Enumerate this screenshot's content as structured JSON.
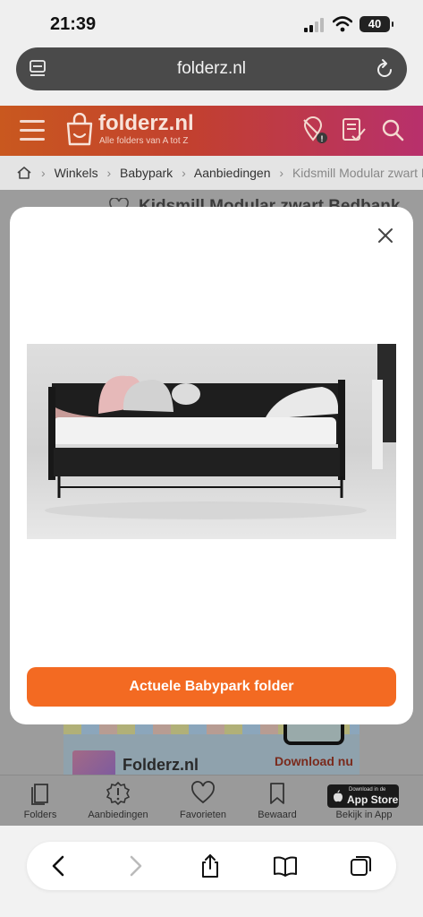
{
  "status_bar": {
    "time": "21:39",
    "battery": "40"
  },
  "browser": {
    "url": "folderz.nl"
  },
  "site_header": {
    "logo_text": "folderz.nl",
    "logo_tagline": "Alle folders van A tot Z"
  },
  "breadcrumb": {
    "items": [
      "Winkels",
      "Babypark",
      "Aanbiedingen"
    ],
    "current": "Kidsmill Modular zwart Bedbank"
  },
  "page": {
    "title": "Kidsmill Modular zwart Bedbank"
  },
  "ad_banner": {
    "brand": "Folderz.nl",
    "download": "Download nu"
  },
  "modal": {
    "cta_label": "Actuele Babypark folder"
  },
  "bottom_nav": {
    "items": [
      {
        "label": "Folders",
        "icon": "folders-icon"
      },
      {
        "label": "Aanbiedingen",
        "icon": "offers-badge-icon"
      },
      {
        "label": "Favorieten",
        "icon": "heart-icon"
      },
      {
        "label": "Bewaard",
        "icon": "bookmark-icon"
      }
    ],
    "appstore_small": "Download in de",
    "appstore_large": "App Store",
    "appstore_caption": "Bekijk in App"
  },
  "colors": {
    "cta": "#f36a22",
    "header_start": "#c9581f",
    "header_end": "#b8306c"
  }
}
